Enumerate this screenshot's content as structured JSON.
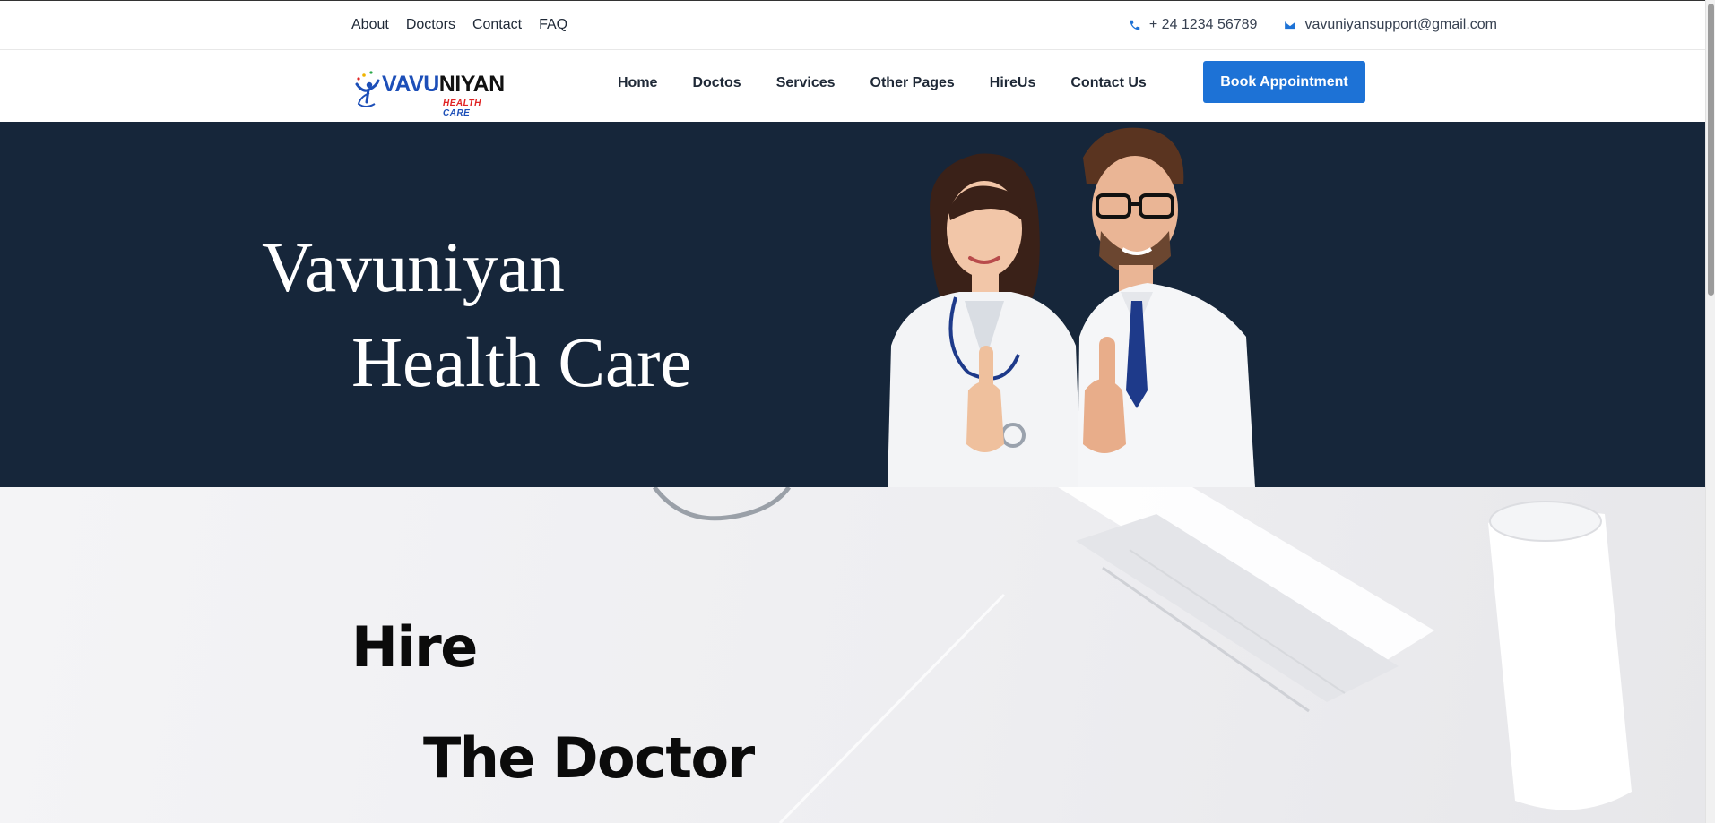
{
  "topbar": {
    "links": [
      "About",
      "Doctors",
      "Contact",
      "FAQ"
    ],
    "phone": "+ 24 1234 56789",
    "email": "vavuniyansupport@gmail.com"
  },
  "logo": {
    "part1": "VAVU",
    "part2": "NIYAN",
    "sub1": "HEALTH",
    "sub2": "CARE"
  },
  "nav": {
    "items": [
      "Home",
      "Doctos",
      "Services",
      "Other Pages",
      "HireUs",
      "Contact Us"
    ],
    "cta": "Book Appointment"
  },
  "hero": {
    "line1": "Vavuniyan",
    "line2": "Health Care"
  },
  "hire": {
    "line1": "Hire",
    "line2": "The Doctor"
  },
  "colors": {
    "accent": "#1d72d6",
    "hero_bg": "#16263a",
    "logo_blue": "#1d4fb8",
    "logo_red": "#e02424"
  },
  "icons": [
    "phone-icon",
    "email-icon",
    "logo-icon"
  ]
}
